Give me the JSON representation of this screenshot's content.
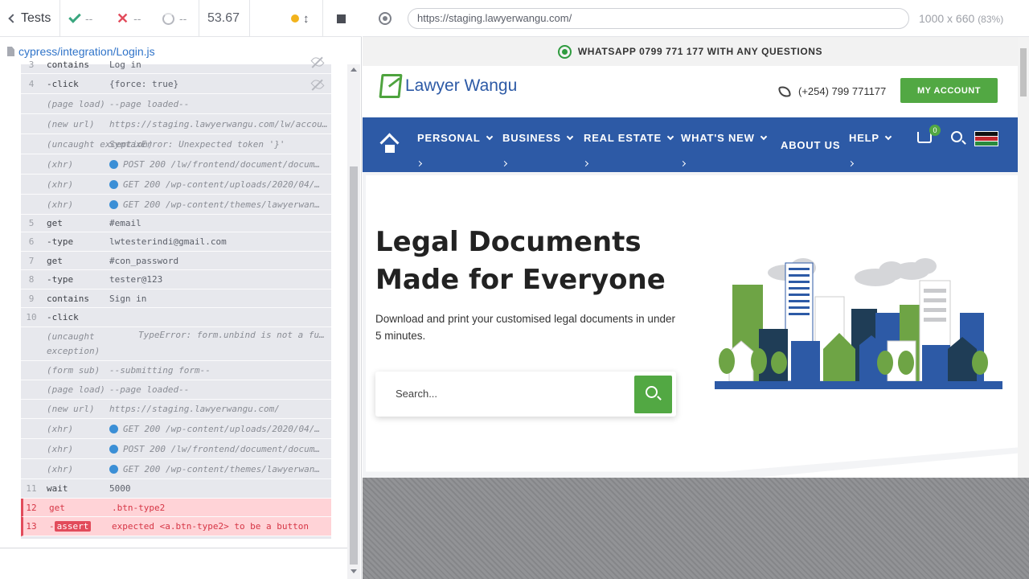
{
  "stats": {
    "back_label": "Tests",
    "passed": "--",
    "failed": "--",
    "pending": "--",
    "duration": "53.67"
  },
  "spec": {
    "path": "cypress/integration/Login.js"
  },
  "commands": [
    {
      "num": "3",
      "name": "contains",
      "msg": "Log in",
      "type": "cmd",
      "clipped": true
    },
    {
      "num": "4",
      "name": "-click",
      "msg": "{force: true}",
      "type": "cmd",
      "eye": true
    },
    {
      "num": "",
      "name": "(page load)",
      "msg": "--page loaded--",
      "type": "event"
    },
    {
      "num": "",
      "name": "(new url)",
      "msg": "https://staging.lawyerwangu.com/lw/accou…",
      "type": "event"
    },
    {
      "num": "",
      "name": "(uncaught exception)",
      "msg": "SyntaxError: Unexpected token '}'",
      "type": "event"
    },
    {
      "num": "",
      "name": "(xhr)",
      "msg": "POST 200 /lw/frontend/document/docum…",
      "type": "xhr"
    },
    {
      "num": "",
      "name": "(xhr)",
      "msg": "GET 200 /wp-content/uploads/2020/04/…",
      "type": "xhr"
    },
    {
      "num": "",
      "name": "(xhr)",
      "msg": "GET 200 /wp-content/themes/lawyerwan…",
      "type": "xhr"
    },
    {
      "num": "5",
      "name": "get",
      "msg": "#email",
      "type": "cmd"
    },
    {
      "num": "6",
      "name": "-type",
      "msg": "lwtesterindi@gmail.com",
      "type": "cmd"
    },
    {
      "num": "7",
      "name": "get",
      "msg": "#con_password",
      "type": "cmd"
    },
    {
      "num": "8",
      "name": "-type",
      "msg": "tester@123",
      "type": "cmd"
    },
    {
      "num": "9",
      "name": "contains",
      "msg": "Sign in",
      "type": "cmd"
    },
    {
      "num": "10",
      "name": "-click",
      "msg": "",
      "type": "cmd"
    },
    {
      "num": "",
      "name": "(uncaught exception)",
      "msg": "TypeError: form.unbind is not a fu…",
      "type": "event2"
    },
    {
      "num": "",
      "name": "(form sub)",
      "msg": "--submitting form--",
      "type": "event"
    },
    {
      "num": "",
      "name": "(page load)",
      "msg": "--page loaded--",
      "type": "event"
    },
    {
      "num": "",
      "name": "(new url)",
      "msg": "https://staging.lawyerwangu.com/",
      "type": "event"
    },
    {
      "num": "",
      "name": "(xhr)",
      "msg": "GET 200 /wp-content/uploads/2020/04/…",
      "type": "xhr"
    },
    {
      "num": "",
      "name": "(xhr)",
      "msg": "POST 200 /lw/frontend/document/docum…",
      "type": "xhr"
    },
    {
      "num": "",
      "name": "(xhr)",
      "msg": "GET 200 /wp-content/themes/lawyerwan…",
      "type": "xhr"
    },
    {
      "num": "11",
      "name": "wait",
      "msg": "5000",
      "type": "cmd"
    },
    {
      "num": "12",
      "name": "get",
      "msg": ".btn-type2",
      "type": "fail"
    },
    {
      "num": "13",
      "name": "-",
      "badge": "assert",
      "msg": "expected <a.btn-type2> to be a button",
      "type": "fail"
    }
  ],
  "toolbar": {
    "url": "https://staging.lawyerwangu.com/",
    "viewport": "1000 x 660",
    "zoom": "(83%)"
  },
  "site": {
    "topbar": "WHATSAPP 0799 771 177 WITH ANY QUESTIONS",
    "logo": "Lawyer Wangu",
    "phone": "(+254) 799 771177",
    "account": "MY ACCOUNT",
    "nav": {
      "personal": "PERSONAL",
      "business": "BUSINESS",
      "real_estate": "REAL ESTATE",
      "whats_new": "WHAT'S NEW",
      "about": "ABOUT US",
      "help": "HELP"
    },
    "cart_count": "0",
    "headline": "Legal Documents Made for Everyone",
    "subline": "Download and print your customised legal documents in under 5 minutes.",
    "search_placeholder": "Search..."
  },
  "colors": {
    "brand_blue": "#2d5aa6",
    "brand_green": "#52a843",
    "fail_red": "#e24b5b"
  }
}
